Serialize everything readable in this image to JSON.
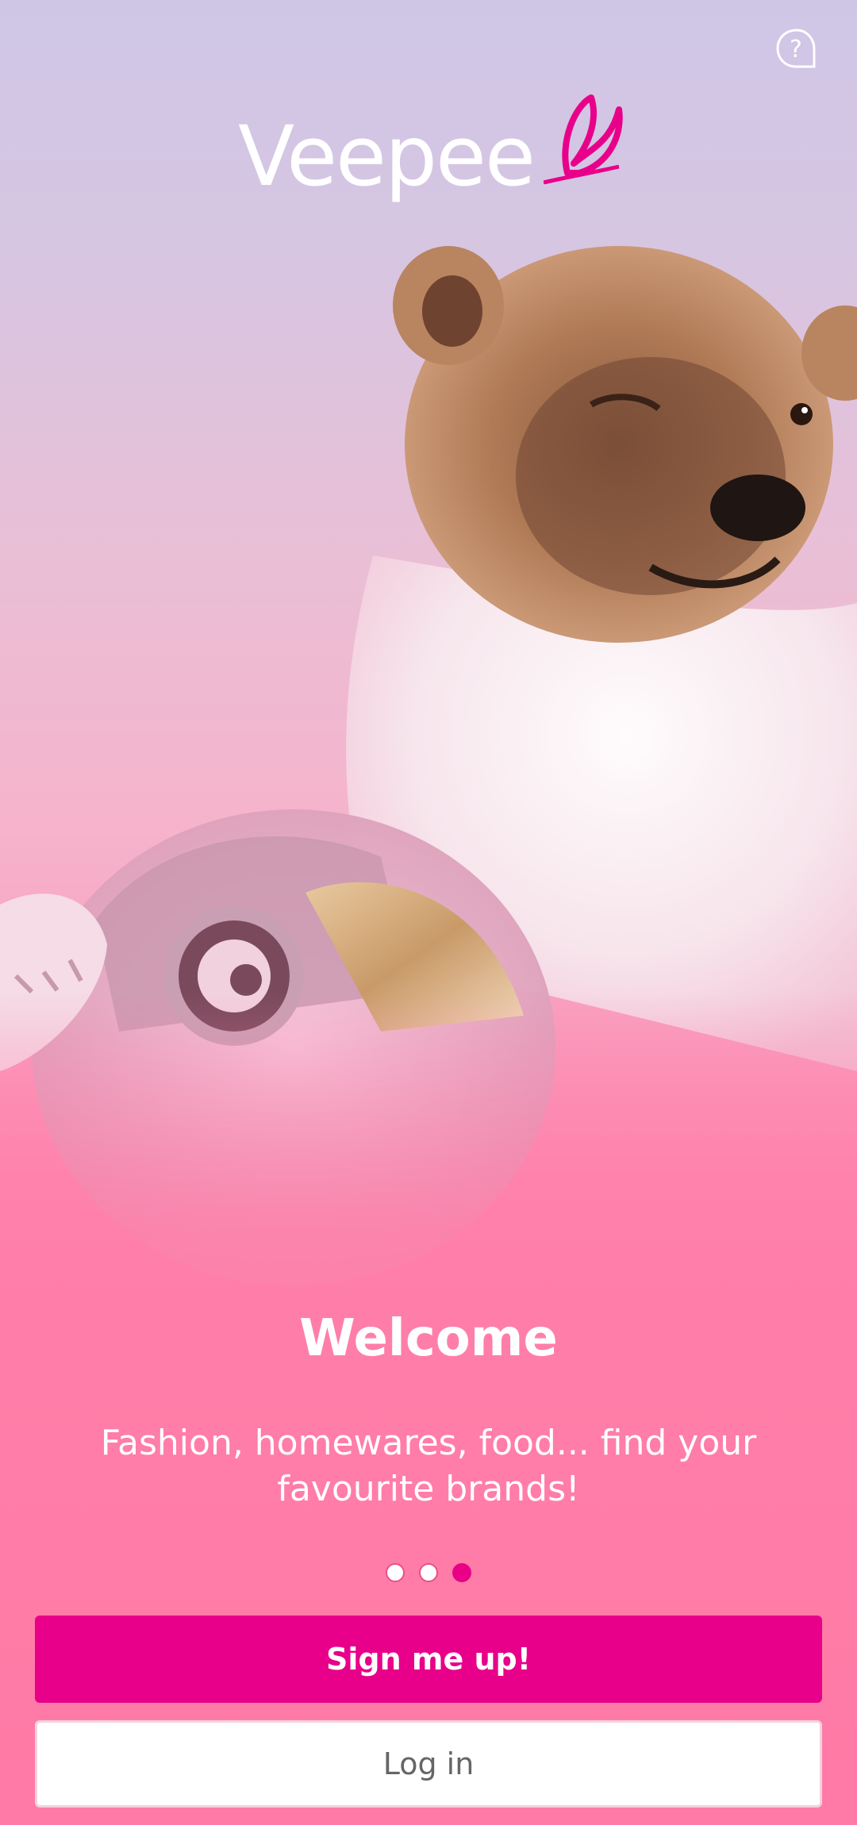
{
  "brand": {
    "name": "Veepee",
    "accent_color": "#ea0086"
  },
  "help": {
    "icon": "help-question-icon",
    "glyph": "?"
  },
  "onboarding": {
    "title": "Welcome",
    "subtitle": "Fashion, homewares, food... find your favourite brands!",
    "pages_total": 3,
    "active_page": 3
  },
  "actions": {
    "signup_label": "Sign me up!",
    "login_label": "Log in"
  },
  "hero": {
    "illustration": "bear-with-helmet-illustration"
  }
}
